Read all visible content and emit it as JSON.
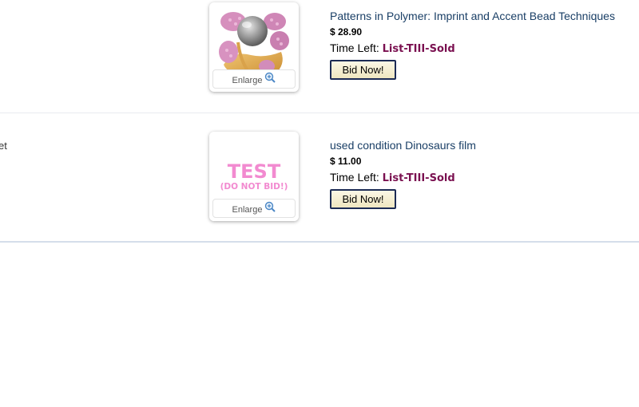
{
  "listings": [
    {
      "title": "Patterns in Polymer: Imprint and Accent Bead Techniques",
      "price": "$ 28.90",
      "time_left_label": "Time Left:",
      "time_left_value": "List-TIII-Sold",
      "bid_label": "Bid Now!",
      "enlarge_label": "Enlarge",
      "image": "pearl-ring-thumbnail"
    },
    {
      "partial_left_text": "et",
      "title": "used condition Dinosaurs film",
      "price": "$ 11.00",
      "time_left_label": "Time Left:",
      "time_left_value": "List-TIII-Sold",
      "bid_label": "Bid Now!",
      "enlarge_label": "Enlarge",
      "image": "test-placeholder-thumbnail",
      "image_text_main": "TEST",
      "image_text_sub": "(DO NOT BID!)"
    }
  ],
  "colors": {
    "title_link": "#1a3f66",
    "time_left_value": "#7a1050",
    "test_text": "#f28ad0",
    "button_border": "#1c2b55"
  },
  "icons": {
    "enlarge": "zoom-in-icon"
  }
}
